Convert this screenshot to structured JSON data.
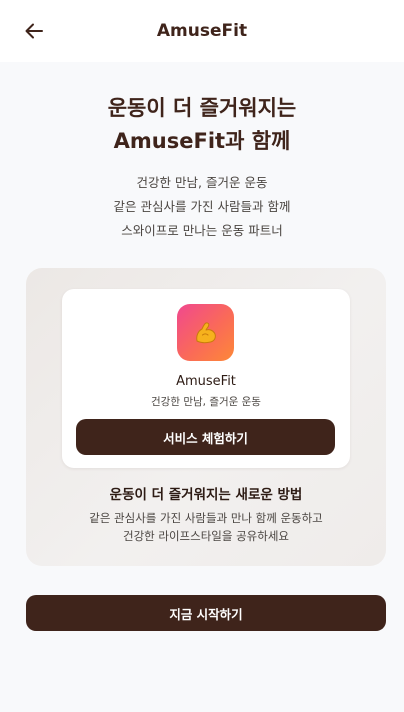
{
  "header": {
    "title": "AmuseFit",
    "back_icon": "arrow-left-icon"
  },
  "hero": {
    "title_line1": "운동이 더 즐거워지는",
    "title_line2": "AmuseFit과 함께",
    "subtitle_lines": [
      "건강한 만남, 즐거운 운동",
      "같은 관심사를 가진 사람들과 함께",
      "스와이프로 만나는 운동 파트너"
    ]
  },
  "preview": {
    "app_icon": "flexed-biceps-icon",
    "app_name": "AmuseFit",
    "app_tagline": "건강한 만남, 즐거운 운동",
    "try_button_label": "서비스 체험하기",
    "heading": "운동이 더 즐거워지는 새로운 방법",
    "description_lines": [
      "같은 관심사를 가진 사람들과 만나 함께 운동하고",
      "건강한 라이프스타일을 공유하세요"
    ]
  },
  "cta": {
    "start_label": "지금 시작하기"
  },
  "colors": {
    "primary_brown": "#3f241b",
    "page_background": "#f8f9fb",
    "icon_gradient_start": "#f0488f",
    "icon_gradient_end": "#fd8838"
  }
}
